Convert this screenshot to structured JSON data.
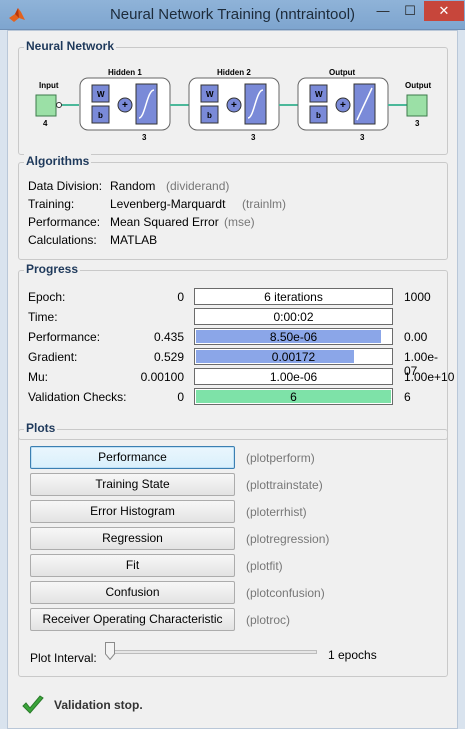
{
  "window": {
    "title": "Neural Network Training (nntraintool)",
    "minimize_glyph": "—",
    "maximize_glyph": "☐",
    "close_glyph": "✕"
  },
  "neural_network": {
    "section_title": "Neural Network",
    "input": {
      "label": "Input",
      "size": "4"
    },
    "hidden1": {
      "label": "Hidden 1",
      "size": "3"
    },
    "hidden2": {
      "label": "Hidden 2",
      "size": "3"
    },
    "output_layer": {
      "label": "Output",
      "size": "3"
    },
    "output": {
      "label": "Output",
      "size": "3"
    },
    "weight_label": "W",
    "bias_label": "b",
    "colors": {
      "layer_box": "#7a8ad8",
      "io_box": "#9be0a6",
      "wire": "#4bb89a"
    }
  },
  "algorithms": {
    "section_title": "Algorithms",
    "rows": [
      {
        "label": "Data Division:",
        "value": "Random",
        "fn": "(dividerand)"
      },
      {
        "label": "Training:",
        "value": "Levenberg-Marquardt",
        "fn": "(trainlm)"
      },
      {
        "label": "Performance:",
        "value": "Mean Squared Error",
        "fn": "(mse)"
      },
      {
        "label": "Calculations:",
        "value": "MATLAB",
        "fn": ""
      }
    ]
  },
  "progress": {
    "section_title": "Progress",
    "rows": [
      {
        "label": "Epoch:",
        "min": "0",
        "text": "6 iterations",
        "max": "1000",
        "fill": 0,
        "color": "blue"
      },
      {
        "label": "Time:",
        "min": "",
        "text": "0:00:02",
        "max": "",
        "fill": 0,
        "color": "blue"
      },
      {
        "label": "Performance:",
        "min": "0.435",
        "text": "8.50e-06",
        "max": "0.00",
        "fill": 0.95,
        "color": "blue"
      },
      {
        "label": "Gradient:",
        "min": "0.529",
        "text": "0.00172",
        "max": "1.00e-07",
        "fill": 0.81,
        "color": "blue"
      },
      {
        "label": "Mu:",
        "min": "0.00100",
        "text": "1.00e-06",
        "max": "1.00e+10",
        "fill": 0,
        "color": "blue"
      },
      {
        "label": "Validation Checks:",
        "min": "0",
        "text": "6",
        "max": "6",
        "fill": 1.0,
        "color": "green"
      }
    ]
  },
  "plots": {
    "section_title": "Plots",
    "buttons": [
      {
        "label": "Performance",
        "fn": "(plotperform)"
      },
      {
        "label": "Training State",
        "fn": "(plottrainstate)"
      },
      {
        "label": "Error Histogram",
        "fn": "(ploterrhist)"
      },
      {
        "label": "Regression",
        "fn": "(plotregression)"
      },
      {
        "label": "Fit",
        "fn": "(plotfit)"
      },
      {
        "label": "Confusion",
        "fn": "(plotconfusion)"
      },
      {
        "label": "Receiver Operating Characteristic",
        "fn": "(plotroc)"
      }
    ],
    "interval_label": "Plot Interval:",
    "interval_value": "1 epochs",
    "slider_fraction": 0
  },
  "status": {
    "icon": "checkmark-icon",
    "text": "Validation stop."
  }
}
